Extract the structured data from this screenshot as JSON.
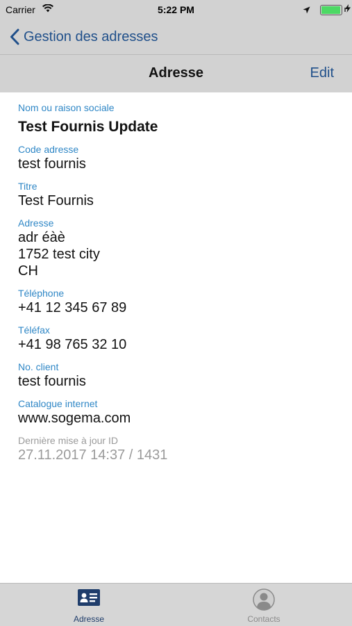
{
  "status_bar": {
    "carrier": "Carrier",
    "time": "5:22 PM"
  },
  "nav": {
    "back_label": "Gestion des adresses"
  },
  "toolbar": {
    "title": "Adresse",
    "edit_label": "Edit"
  },
  "fields": {
    "name": {
      "label": "Nom ou raison sociale",
      "value": "Test Fournis Update"
    },
    "code": {
      "label": "Code adresse",
      "value": "test fournis"
    },
    "titre": {
      "label": "Titre",
      "value": "Test Fournis"
    },
    "adresse": {
      "label": "Adresse",
      "line1": "adr éàè",
      "line2": "1752 test city",
      "line3": "CH"
    },
    "telephone": {
      "label": "Téléphone",
      "value": "+41 12 345 67 89"
    },
    "telefax": {
      "label": "Téléfax",
      "value": "+41 98 765 32 10"
    },
    "client": {
      "label": "No. client",
      "value": "test fournis"
    },
    "catalogue": {
      "label": "Catalogue internet",
      "value": "www.sogema.com"
    },
    "update": {
      "label": "Dernière mise à jour ID",
      "value": "27.11.2017 14:37 / 1431"
    }
  },
  "tabs": {
    "adresse": {
      "label": "Adresse",
      "icon": "address-card-icon"
    },
    "contacts": {
      "label": "Contacts",
      "icon": "person-icon"
    }
  },
  "colors": {
    "accent": "#1f4f8a",
    "label": "#2f87c6",
    "bar_bg": "#d2d2d2",
    "muted": "#9a9a9a",
    "battery": "#4cd964"
  },
  "battery_level": 1.0
}
